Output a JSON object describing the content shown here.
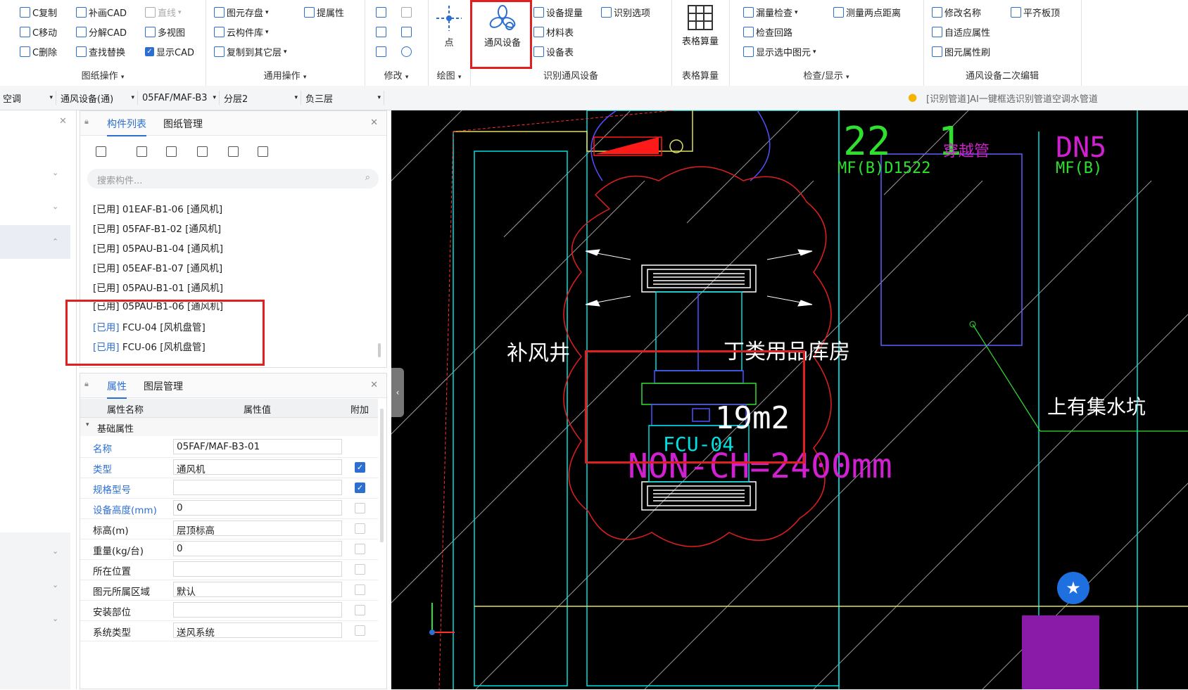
{
  "ribbon": {
    "drawing_ops": {
      "title": "图纸操作",
      "copy": "C复制",
      "move": "C移动",
      "delete": "C删除",
      "add_cad": "补画CAD",
      "split_cad": "分解CAD",
      "find_replace": "查找替换",
      "line": "直线",
      "multi_view": "多视图",
      "show_cad": "显示CAD"
    },
    "general_ops": {
      "title": "通用操作",
      "elem_save": "图元存盘",
      "cloud_lib": "云构件库",
      "copy_floor": "复制到其它层",
      "pick_attr": "提属性"
    },
    "modify": {
      "title": "修改"
    },
    "draw": {
      "title": "绘图",
      "point": "点"
    },
    "identify": {
      "title": "识别通风设备",
      "vent_device": "通风设备",
      "device_extract": "设备提量",
      "material_table": "材料表",
      "device_table": "设备表",
      "identify_option": "识别选项"
    },
    "table_calc": {
      "title": "表格算量",
      "label": "表格算量"
    },
    "check_show": {
      "title": "检查/显示",
      "leak_check": "漏量检查",
      "measure": "测量两点距离",
      "check_loop": "检查回路",
      "show_selected": "显示选中图元"
    },
    "secondary_edit": {
      "title": "通风设备二次编辑",
      "rename": "修改名称",
      "flat_top": "平齐板顶",
      "adaptive_attr": "自适应属性",
      "attr_brush": "图元属性刷"
    }
  },
  "toolbar2": {
    "combo1": "空调",
    "combo2": "通风设备(通)",
    "combo3": "05FAF/MAF-B3",
    "combo4": "分层2",
    "combo5": "负三层",
    "notice": "[识别管道]AI一键框选识别管道空调水管道"
  },
  "component_panel": {
    "tab_list": "构件列表",
    "tab_drawing": "图纸管理",
    "search_placeholder": "搜索构件...",
    "items": [
      "[已用] 01EAF-B1-06 [通风机]",
      "[已用] 05FAF-B1-02 [通风机]",
      "[已用] 05PAU-B1-04 [通风机]",
      "[已用] 05EAF-B1-07 [通风机]",
      "[已用] 05PAU-B1-01 [通风机]",
      "[已用] 05PAU-B1-06 [通风机]",
      "[已用] FCU-04 [风机盘管]",
      "[已用] FCU-06 [风机盘管]"
    ]
  },
  "property_panel": {
    "tab_attr": "属性",
    "tab_layer": "图层管理",
    "col_name": "属性名称",
    "col_value": "属性值",
    "col_extra": "附加",
    "section": "基础属性",
    "rows": [
      {
        "name": "名称",
        "value": "05FAF/MAF-B3-01",
        "checked": false,
        "showchk": false
      },
      {
        "name": "类型",
        "value": "通风机",
        "checked": true,
        "showchk": true
      },
      {
        "name": "规格型号",
        "value": "",
        "checked": true,
        "showchk": true
      },
      {
        "name": "设备高度(mm)",
        "value": "0",
        "checked": false,
        "showchk": true
      },
      {
        "name": "标高(m)",
        "value": "层顶标高",
        "checked": false,
        "showchk": true
      },
      {
        "name": "重量(kg/台)",
        "value": "0",
        "checked": false,
        "showchk": true
      },
      {
        "name": "所在位置",
        "value": "",
        "checked": false,
        "showchk": true
      },
      {
        "name": "图元所属区域",
        "value": "默认",
        "checked": false,
        "showchk": true
      },
      {
        "name": "安装部位",
        "value": "",
        "checked": false,
        "showchk": true
      },
      {
        "name": "系统类型",
        "value": "送风系统",
        "checked": false,
        "showchk": true
      }
    ]
  },
  "cad": {
    "label_shaft": "补风井",
    "label_room": "丁类用品库房",
    "label_area": "19m2",
    "label_fcu": "FCU-04",
    "label_height": "NON-CH=2400mm",
    "label_pipe": "MF(B)D1522",
    "label_cross": "穿越管",
    "label_pipe2": "MF(B)",
    "label_dn": "DN5",
    "label_water": "上有集水坑",
    "label_nums": "22  1"
  },
  "colors": {
    "accent": "#2c6fd1",
    "highlight": "#e02020",
    "cad_bg": "#000000"
  }
}
